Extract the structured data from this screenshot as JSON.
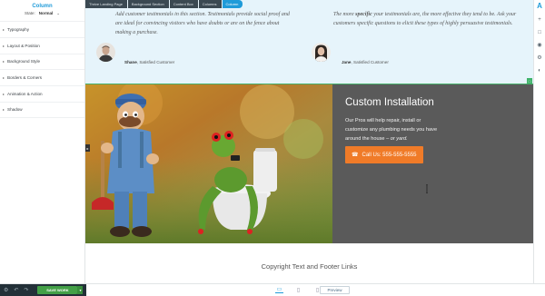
{
  "sidebar": {
    "title": "Column",
    "state_label": "State:",
    "state_value": "Normal",
    "items": [
      {
        "label": "Typography"
      },
      {
        "label": "Layout & Position"
      },
      {
        "label": "Background Style"
      },
      {
        "label": "Borders & Corners"
      },
      {
        "label": "Animation & Action"
      },
      {
        "label": "Shadow"
      }
    ]
  },
  "breadcrumbs": [
    "Thrive Landing Page",
    "Background Section",
    "Content Box",
    "Columns",
    "Column"
  ],
  "testimonials": {
    "left": {
      "quote": "Add customer testimonials in this section. Testimonials provide social proof and are ideal for convincing visitors who have doubts or are on the fence about making a purchase.",
      "name": "Shane",
      "role": ", Satisfied Customer"
    },
    "right": {
      "quote_pre": "The more ",
      "quote_bold": "specific",
      "quote_post": " your testimonials are, the more effective they tend to be. Ask your customers specific questions to elicit these types of highly persuasive testimonials.",
      "name": "Jane",
      "role": ", Satisfied Customer"
    }
  },
  "hero": {
    "title": "Custom Installation",
    "body": "Our Pros will help repair, install or customize any plumbing needs you have around the house –",
    "body_italic": " or yard.",
    "cta": "Call Us: 555-555-5555"
  },
  "footer": {
    "text": "Copyright Text and Footer Links"
  },
  "bottombar": {
    "save_label": "SAVE WORK",
    "preview_label": "Preview"
  },
  "colors": {
    "accent": "#1f9bd9",
    "cta": "#f07b28",
    "save": "#43a047",
    "panel": "#5a5a5a"
  }
}
